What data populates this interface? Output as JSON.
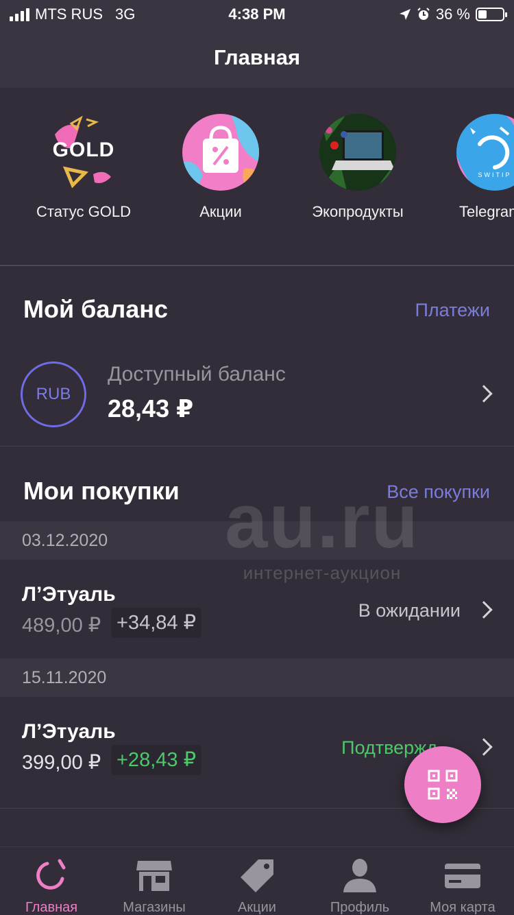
{
  "status_bar": {
    "carrier": "MTS RUS",
    "network": "3G",
    "time": "4:38 PM",
    "battery": "36 %",
    "battery_level": 0.36
  },
  "header": {
    "title": "Главная"
  },
  "stories": [
    {
      "label": "Статус GOLD",
      "badge": "GOLD",
      "icon": "gold-status-icon"
    },
    {
      "label": "Акции",
      "icon": "shopping-bag-percent-icon"
    },
    {
      "label": "Экопродукты",
      "icon": "laptop-icon"
    },
    {
      "label": "Telegram",
      "icon": "telegram-switip-icon",
      "inner_text": "SWITIP"
    }
  ],
  "balance": {
    "title": "Мой баланс",
    "link": "Платежи",
    "currency": "RUB",
    "label": "Доступный баланс",
    "value": "28,43 ₽"
  },
  "purchases": {
    "title": "Мои покупки",
    "link": "Все покупки",
    "groups": [
      {
        "date": "03.12.2020",
        "name": "Л’Этуаль",
        "price": "489,00 ₽",
        "bonus": "+34,84 ₽",
        "status": "В ожидании"
      },
      {
        "date": "15.11.2020",
        "name": "Л’Этуаль",
        "price": "399,00 ₽",
        "bonus": "+28,43 ₽",
        "status": "Подтвержд"
      }
    ]
  },
  "watermark": {
    "brand": "au.ru",
    "tagline": "интернет-аукцион"
  },
  "tabs": [
    {
      "label": "Главная",
      "icon": "home-spinner-icon",
      "active": true
    },
    {
      "label": "Магазины",
      "icon": "store-icon",
      "active": false
    },
    {
      "label": "Акции",
      "icon": "tag-icon",
      "active": false
    },
    {
      "label": "Профиль",
      "icon": "profile-icon",
      "active": false
    },
    {
      "label": "Моя карта",
      "icon": "card-icon",
      "active": false
    }
  ],
  "colors": {
    "background": "#322d38",
    "accent_pink": "#ee7fc7",
    "accent_link": "#7b7dd9",
    "status_pending": "#c8c4cc",
    "status_confirmed": "#4cca6a",
    "bonus_pending": "#c8c4cc",
    "bonus_confirmed": "#4cca6a"
  }
}
